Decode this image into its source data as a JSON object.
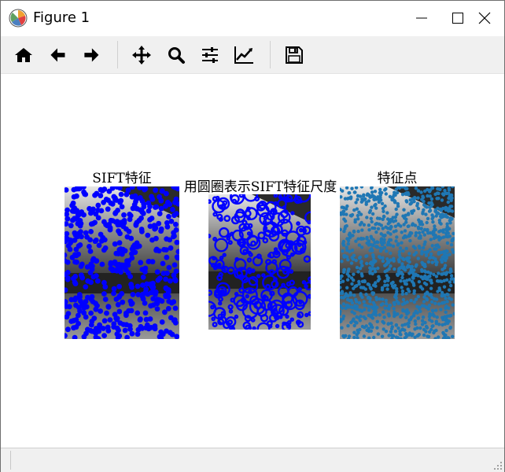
{
  "window": {
    "title": "Figure 1"
  },
  "toolbar": {
    "buttons": [
      "home-icon",
      "back-arrow-icon",
      "forward-arrow-icon",
      "pan-move-icon",
      "zoom-magnifier-icon",
      "configure-subplots-icon",
      "edit-axis-lines-icon",
      "save-floppy-icon"
    ]
  },
  "figure": {
    "subplots": [
      {
        "title": "SIFT特征",
        "content": "grayscale image overlaid with blue filled keypoint markers"
      },
      {
        "title": "用圆圈表示SIFT特征尺度",
        "content": "grayscale image overlaid with blue circles sized by keypoint scale"
      },
      {
        "title": "特征点",
        "content": "grayscale image overlaid with steel-blue keypoint dots"
      }
    ]
  },
  "colors": {
    "marker_blue": "#0000ff",
    "point_steelblue": "#1f77b4",
    "toolbar_bg": "#f0f0f0"
  }
}
